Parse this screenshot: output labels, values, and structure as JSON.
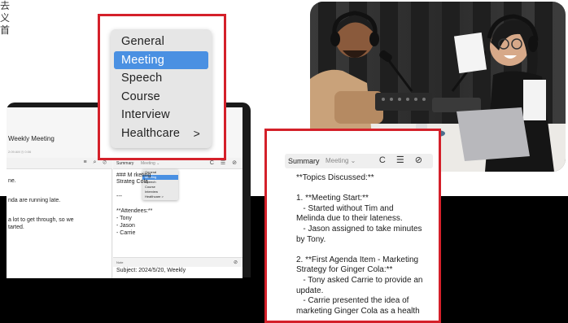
{
  "cjk_fragment": "去\n义\n首",
  "laptop": {
    "window_title": "Weekly Meeting",
    "meta_text": "2:09 AM    ◷ 0:06",
    "left_toolbar_icons": "≡ ⌕ ⊘",
    "transcript_lines": [
      "ne.",
      "nda are running late.",
      "a lot to get through, so we",
      "tarted."
    ],
    "summary_label": "Summary",
    "meeting_label": "Meeting ⌄",
    "right_toolbar_icons": "C ☰ ⊘",
    "mini_menu": [
      "General",
      "Meeting",
      "Speech",
      "Course",
      "Interview",
      "Healthcare >"
    ],
    "summary_text": [
      "### M       rketing",
      "Strateg       Cola",
      "",
      "---",
      "",
      "**Attendees:**",
      "- Tony",
      "- Jason",
      "- Carrie"
    ],
    "note_label": "Note",
    "note_subject": "Subject: 2024/5/20, Weekly"
  },
  "dropdown": {
    "items": [
      {
        "label": "General",
        "selected": false
      },
      {
        "label": "Meeting",
        "selected": true
      },
      {
        "label": "Speech",
        "selected": false
      },
      {
        "label": "Course",
        "selected": false
      },
      {
        "label": "Interview",
        "selected": false
      },
      {
        "label": "Healthcare",
        "selected": false,
        "arrow": ">"
      }
    ]
  },
  "summary_panel": {
    "summary_label": "Summary",
    "meeting_label": "Meeting ⌄",
    "icons": "C ☰ ⊘",
    "text": "**Topics Discussed:**\n\n1. **Meeting Start:**\n   - Started without Tim and\nMelinda due to their lateness.\n   - Jason assigned to take minutes\nby Tony.\n\n2. **First Agenda Item - Marketing\nStrategy for Ginger Cola:**\n   - Tony asked Carrie to provide an\nupdate.\n   - Carrie presented the idea of\nmarketing Ginger Cola as a health"
  },
  "colors": {
    "highlight": "#d4202a",
    "selection": "#4a90e2",
    "band": "#000000"
  }
}
